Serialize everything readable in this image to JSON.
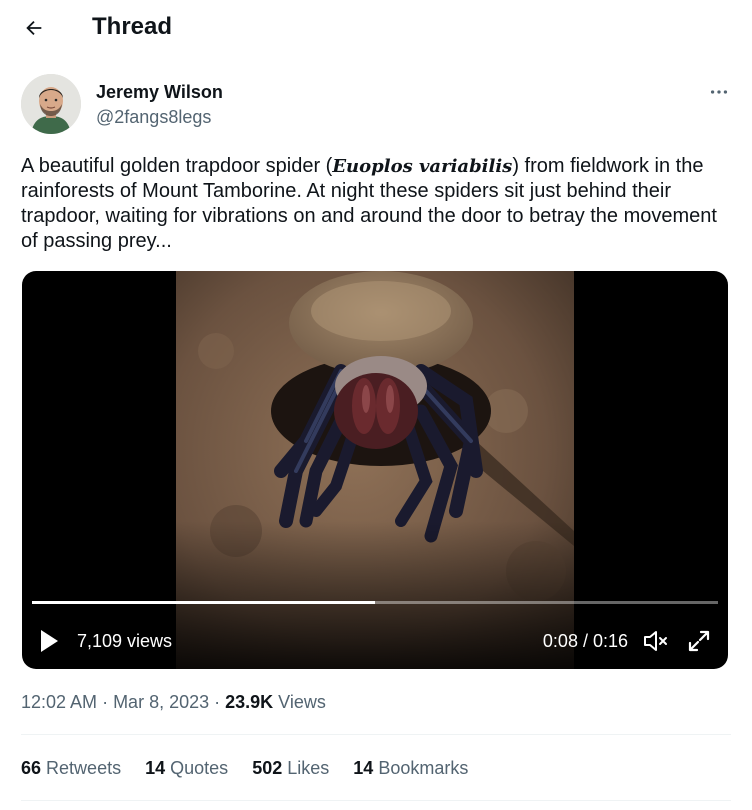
{
  "header": {
    "back_icon": "arrow-left-icon",
    "title": "Thread"
  },
  "author": {
    "name": "Jeremy Wilson",
    "handle": "@2fangs8legs",
    "more_icon": "more-horizontal-icon"
  },
  "tweet": {
    "text_before": "A beautiful golden trapdoor spider (",
    "scientific_name": "Euoplos variabilis",
    "text_after": ") from fieldwork in the rainforests of Mount Tamborine. At night these spiders sit just behind their trapdoor, waiting for vibrations on and around the door to betray the movement of passing prey..."
  },
  "video": {
    "views": "7,109 views",
    "time": "0:08 / 0:16",
    "progress": 0.5,
    "play_icon": "play-icon",
    "mute_icon": "muted-speaker-icon",
    "fullscreen_icon": "fullscreen-icon"
  },
  "meta": {
    "time": "12:02 AM",
    "sep1": " · ",
    "date": "Mar 8, 2023",
    "sep2": " · ",
    "views_count": "23.9K",
    "views_label": " Views"
  },
  "stats": {
    "retweets_count": "66",
    "retweets_label": "Retweets",
    "quotes_count": "14",
    "quotes_label": "Quotes",
    "likes_count": "502",
    "likes_label": "Likes",
    "bookmarks_count": "14",
    "bookmarks_label": "Bookmarks"
  },
  "colors": {
    "text_primary": "#0f1419",
    "text_secondary": "#536471",
    "divider": "#eff3f4",
    "video_bg": "#000000"
  }
}
